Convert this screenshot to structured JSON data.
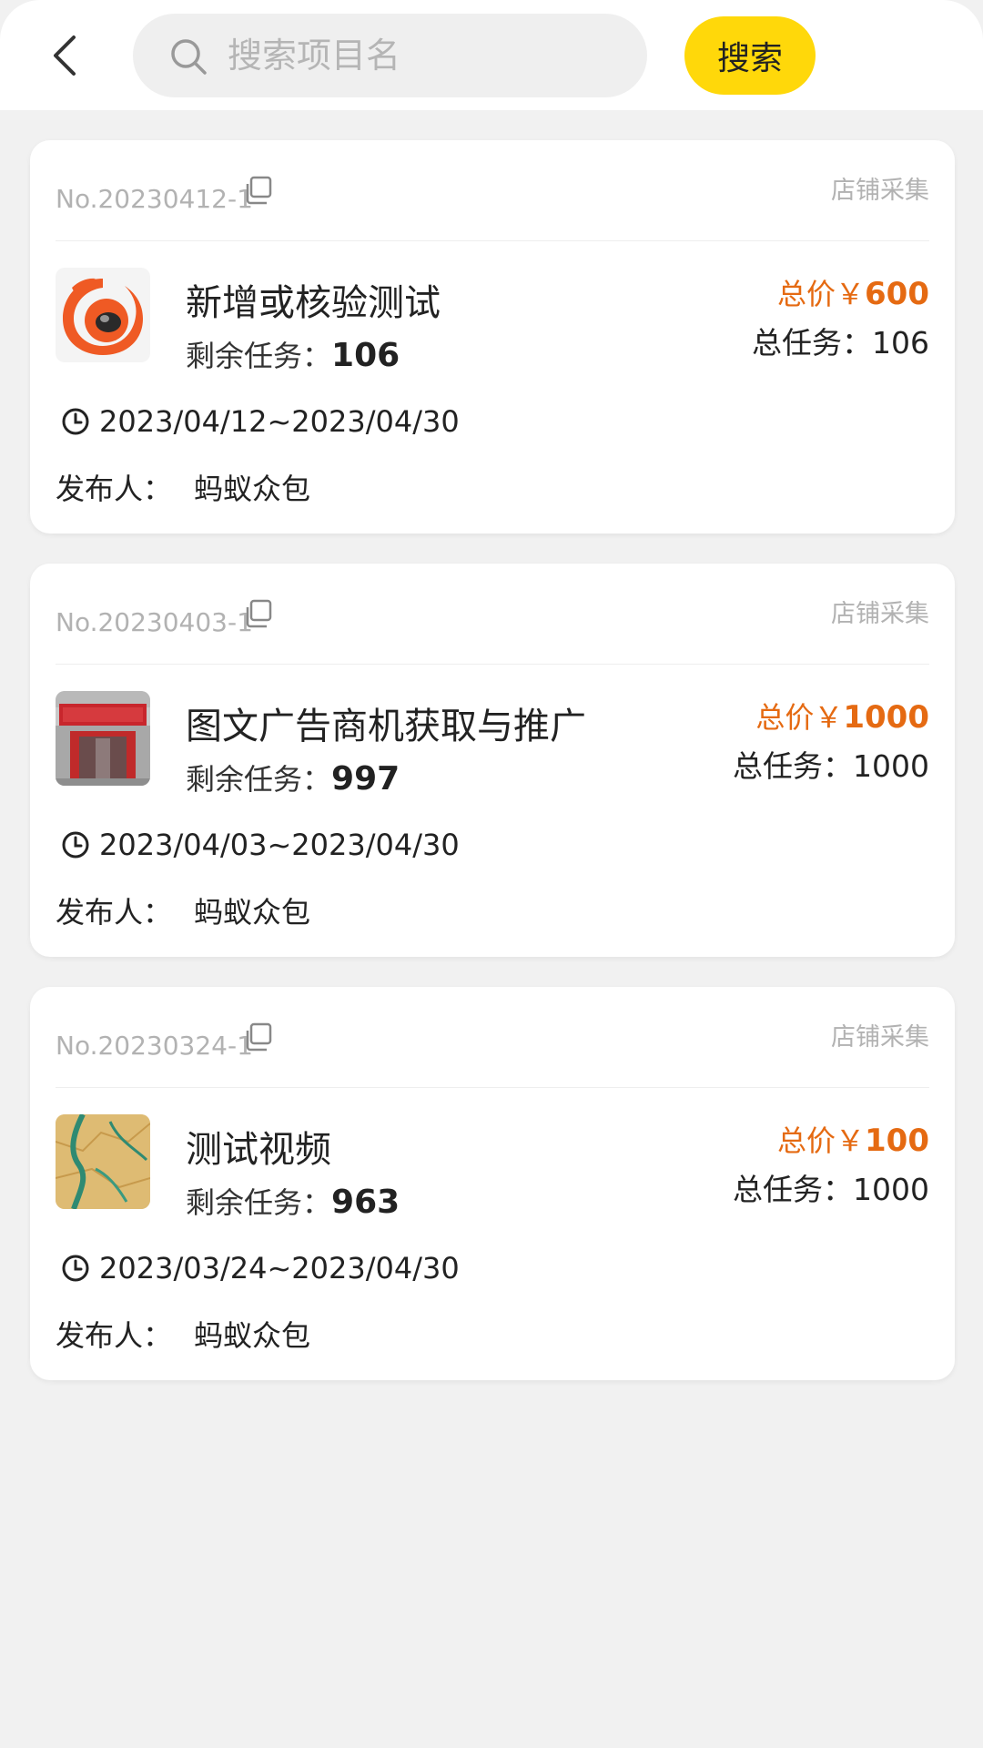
{
  "header": {
    "search_placeholder": "搜索项目名",
    "search_button": "搜索"
  },
  "icons": {
    "back": "back-arrow-icon",
    "search": "search-icon",
    "copy": "copy-icon",
    "clock": "clock-icon"
  },
  "colors": {
    "accent": "#ffd80a",
    "price": "#e56a12"
  },
  "labels": {
    "remaining": "剩余任务：",
    "price_prefix": "总价￥",
    "total_prefix": "总任务：",
    "publisher": "发布人："
  },
  "projects": [
    {
      "no": "No.20230412-1",
      "source": "店铺采集",
      "title": "新增或核验测试",
      "remaining": "106",
      "price": "600",
      "total": "106",
      "date_range": "2023/04/12~2023/04/30",
      "publisher": "蚂蚁众包",
      "thumb": "orange-logo"
    },
    {
      "no": "No.20230403-1",
      "source": "店铺采集",
      "title": "图文广告商机获取与推广",
      "remaining": "997",
      "price": "1000",
      "total": "1000",
      "date_range": "2023/04/03~2023/04/30",
      "publisher": "蚂蚁众包",
      "thumb": "storefront-photo"
    },
    {
      "no": "No.20230324-1",
      "source": "店铺采集",
      "title": "测试视频",
      "remaining": "963",
      "price": "100",
      "total": "1000",
      "date_range": "2023/03/24~2023/04/30",
      "publisher": "蚂蚁众包",
      "thumb": "map-image"
    }
  ]
}
